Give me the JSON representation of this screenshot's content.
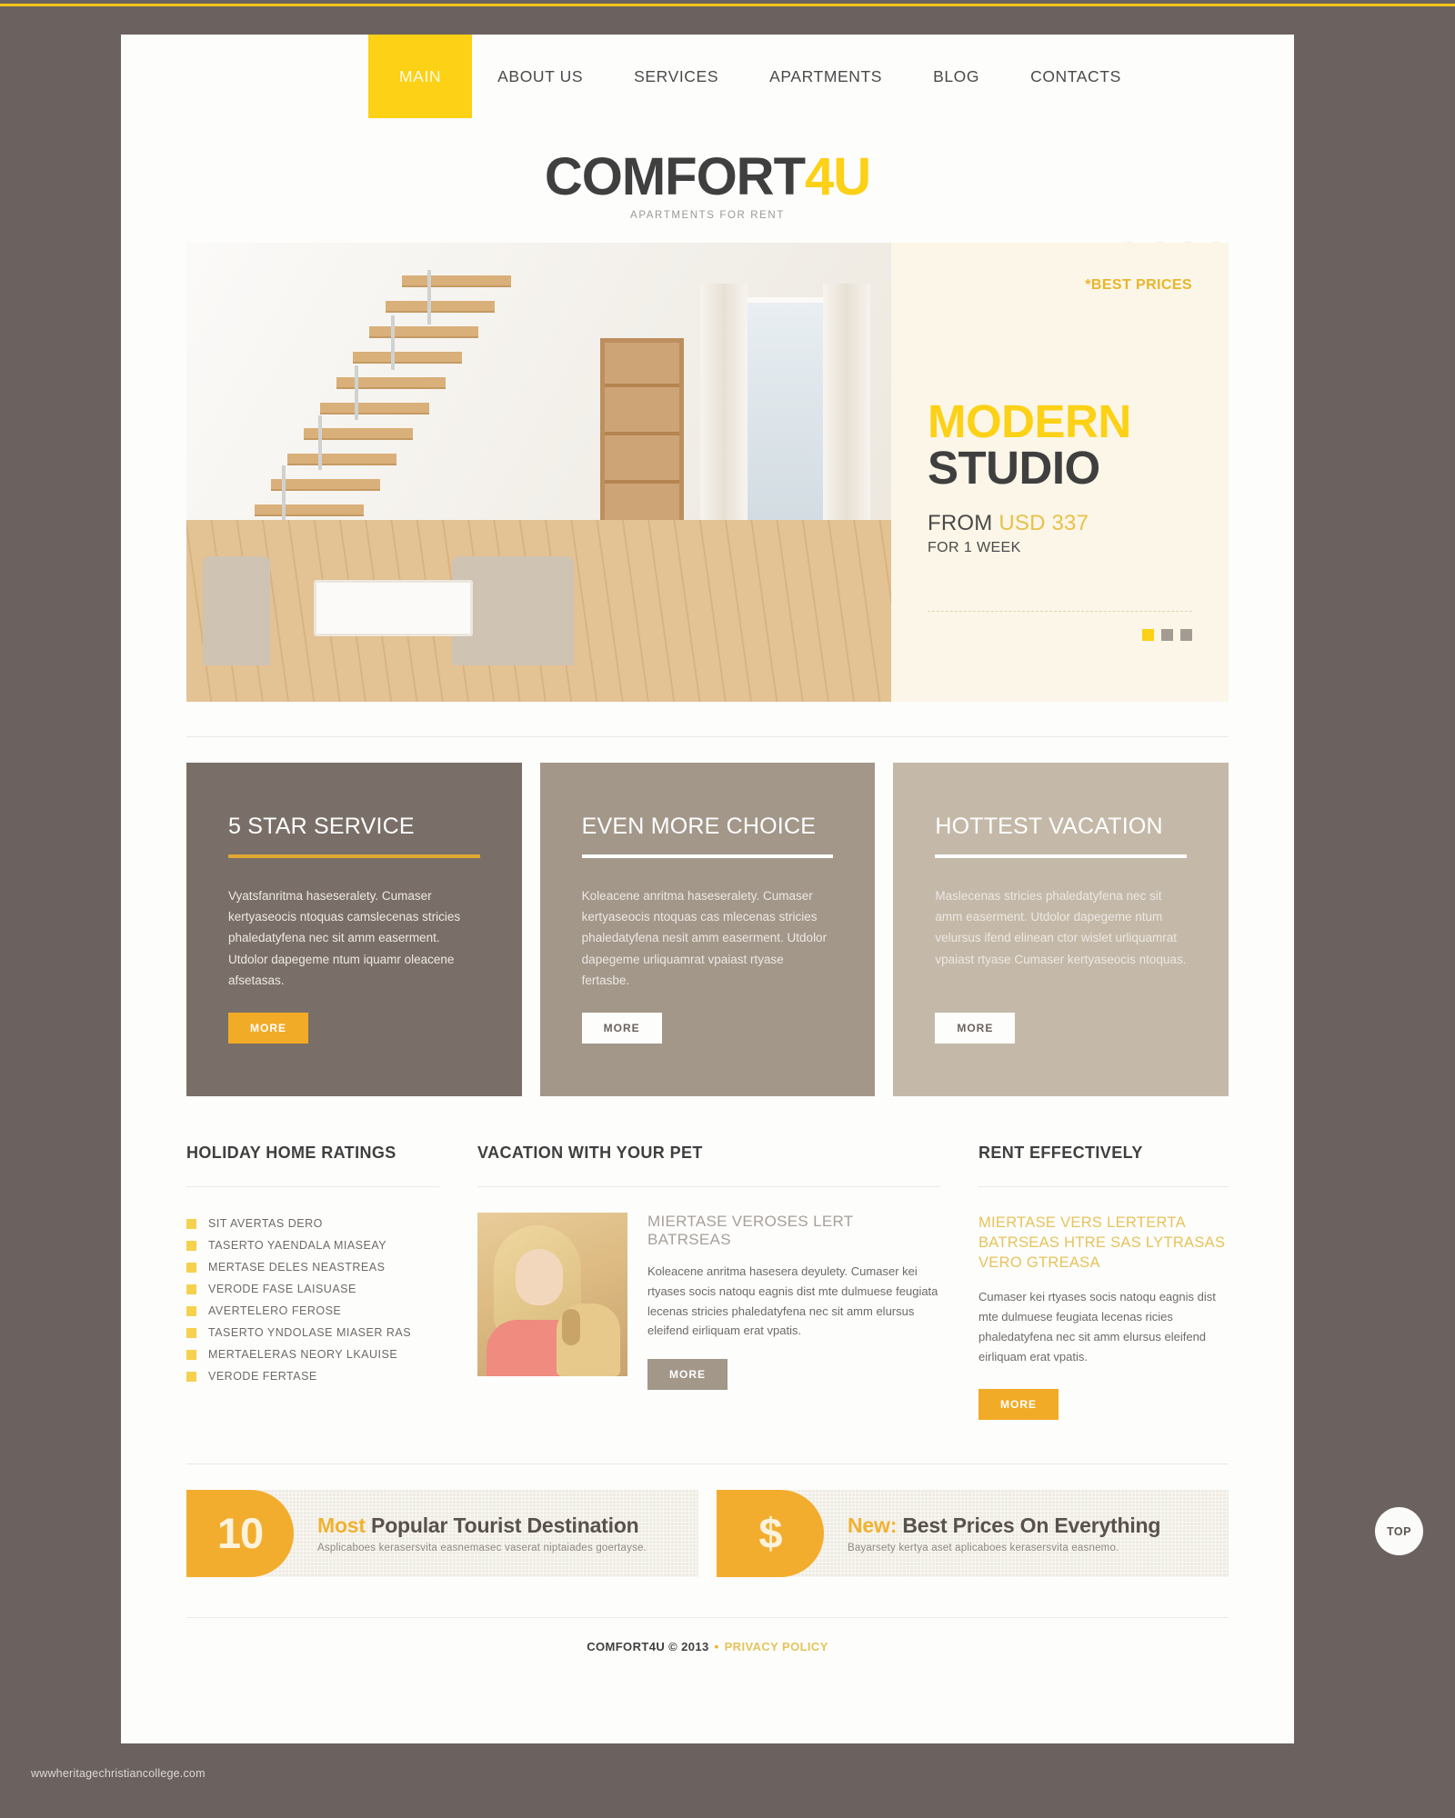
{
  "nav": {
    "items": [
      {
        "label": "MAIN",
        "active": true
      },
      {
        "label": "ABOUT US",
        "active": false
      },
      {
        "label": "SERVICES",
        "active": false
      },
      {
        "label": "APARTMENTS",
        "active": false
      },
      {
        "label": "BLOG",
        "active": false
      },
      {
        "label": "CONTACTS",
        "active": false
      }
    ]
  },
  "logo": {
    "main": "COMFORT",
    "accent": "4U",
    "tagline": "APARTMENTS FOR RENT"
  },
  "social": {
    "items": [
      {
        "name": "twitter-icon",
        "glyph": "ᴠ"
      },
      {
        "name": "facebook-icon",
        "glyph": "f"
      },
      {
        "name": "google-plus-icon",
        "glyph": "g"
      },
      {
        "name": "rss-icon",
        "glyph": "◔"
      }
    ]
  },
  "hero": {
    "badge": "*BEST PRICES",
    "title_accent": "MODERN",
    "title_main": "STUDIO",
    "price_from": "FROM",
    "price_amount": "USD 337",
    "price_period": "FOR 1 WEEK",
    "dots": [
      {
        "active": true
      },
      {
        "active": false
      },
      {
        "active": false
      }
    ]
  },
  "cards": [
    {
      "title": "5 STAR SERVICE",
      "text": "Vyatsfanritma haseseralety. Cumaser kertyaseocis ntoquas camslecenas stricies phaledatyfena nec sit amm easerment. Utdolor dapegeme ntum iquamr oleacene afsetasas.",
      "button": "MORE"
    },
    {
      "title": "EVEN MORE CHOICE",
      "text": "Koleacene anritma haseseralety. Cumaser kertyaseocis ntoquas cas mlecenas stricies phaledatyfena nesit amm easerment. Utdolor dapegeme urliquamrat vpaiast rtyase fertasbe.",
      "button": "MORE"
    },
    {
      "title": "HOTTEST VACATION",
      "text": "Maslecenas stricies phaledatyfena nec sit amm easerment. Utdolor dapegeme ntum velursus ifend elinean ctor wislet urliquamrat vpaiast rtyase Cumaser kertyaseocis ntoquas.",
      "button": "MORE"
    }
  ],
  "ratings": {
    "title": "HOLIDAY HOME RATINGS",
    "items": [
      "SIT AVERTAS DERO",
      "TASERTO YAENDALA MIASEAY",
      "MERTASE DELES NEASTREAS",
      "VERODE FASE LAISUASE",
      "AVERTELERO FEROSE",
      "TASERTO YNDOLASE MIASER RAS",
      "MERTAELERAS NEORY LKAUISE",
      "VERODE FERTASE"
    ]
  },
  "pet": {
    "title": "VACATION WITH YOUR PET",
    "subtitle": "MIERTASE VEROSES LERT BATRSEAS",
    "text": "Koleacene anritma hasesera deyulety. Cumaser kei rtyases socis natoqu eagnis dist mte dulmuese feugiata lecenas stricies phaledatyfena nec sit amm elursus eleifend eirliquam erat vpatis.",
    "button": "MORE"
  },
  "rent": {
    "title": "RENT EFFECTIVELY",
    "subtitle": "MIERTASE VERS LERTERTA BATRSEAS HTRE SAS LYTRASAS VERO GTREASA",
    "text": "Cumaser kei rtyases socis natoqu eagnis dist mte dulmuese feugiata lecenas ricies phaledatyfena nec sit amm elursus eleifend eirliquam erat vpatis.",
    "button": "MORE"
  },
  "promos": [
    {
      "badge": "10",
      "head_accent": "Most",
      "head_rest": " Popular Tourist Destination",
      "sub": "Asplicaboes kerasersvita easnemasec vaserat niptaiades goertayse."
    },
    {
      "badge": "$",
      "head_accent": "New:",
      "head_rest": " Best Prices On Everything",
      "sub": "Bayarsety kertya aset aplicaboes kerasersvita easnemo."
    }
  ],
  "footer": {
    "copyright": "COMFORT4U © 2013",
    "separator": "•",
    "privacy": "PRIVACY POLICY"
  },
  "top_button": {
    "label": "TOP"
  },
  "watermark": {
    "text": "wwwheritagechristiancollege.com"
  },
  "colors": {
    "accent_yellow": "#fcd116",
    "button_orange": "#f2ab27",
    "page_bg": "#6b625f",
    "card1": "#7a6f68",
    "card2": "#a3978a",
    "card3": "#c4b9a8",
    "hero_panel": "#fbf6e7"
  }
}
